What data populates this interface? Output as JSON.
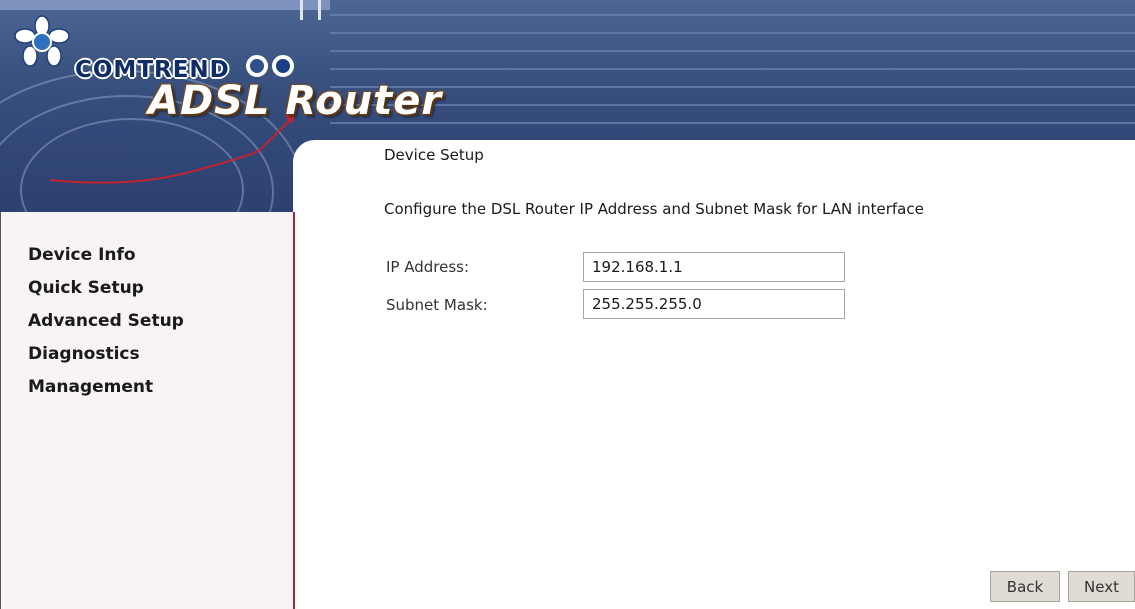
{
  "header": {
    "brand": "COMTREND",
    "product_title": "ADSL Router",
    "icons": [
      "comtrend-flower-logo-icon",
      "blue-rings-icon"
    ]
  },
  "sidebar": {
    "items": [
      {
        "label": "Device Info"
      },
      {
        "label": "Quick Setup"
      },
      {
        "label": "Advanced Setup"
      },
      {
        "label": "Diagnostics"
      },
      {
        "label": "Management"
      }
    ]
  },
  "main": {
    "title": "Device Setup",
    "description": "Configure the DSL Router IP Address and Subnet Mask for LAN interface",
    "fields": {
      "ip_label": "IP Address:",
      "ip_value": "192.168.1.1",
      "mask_label": "Subnet Mask:",
      "mask_value": "255.255.255.0"
    },
    "buttons": {
      "back": "Back",
      "next": "Next"
    }
  },
  "colors": {
    "banner": "#3a527f",
    "sidebar_border": "#a52a3a",
    "sidebar_bg": "#f7f3f7",
    "brand_text": "#0e2d66"
  }
}
